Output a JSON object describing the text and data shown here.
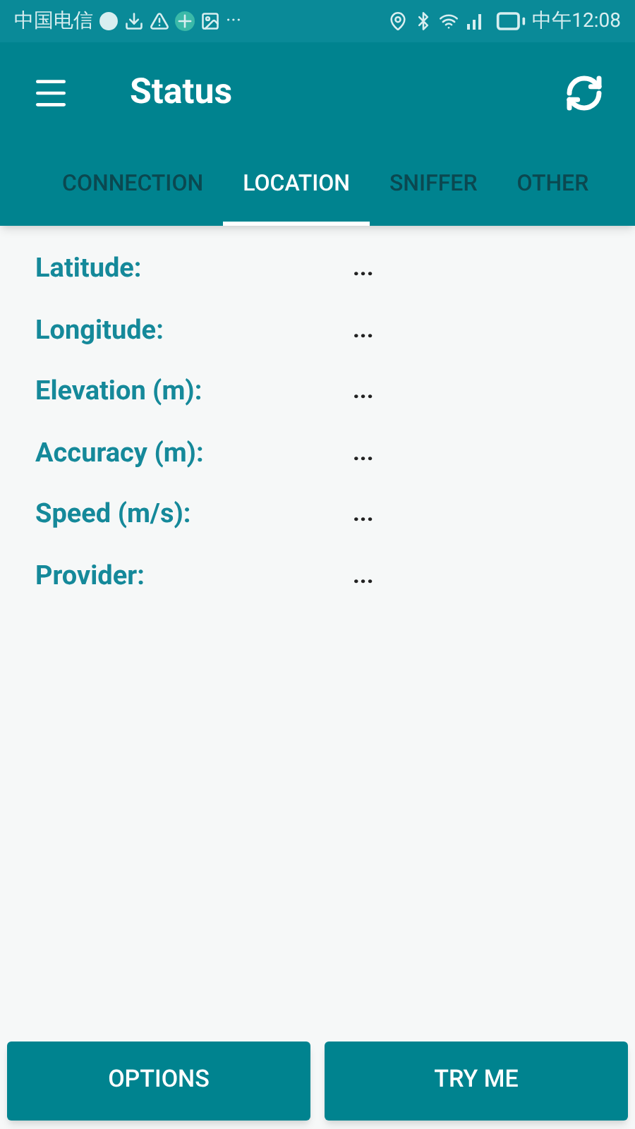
{
  "status_bar": {
    "carrier": "中国电信",
    "more": "···",
    "time": "中午12:08"
  },
  "app_bar": {
    "title": "Status"
  },
  "tabs": [
    {
      "label": "CONNECTION",
      "selected": false
    },
    {
      "label": "LOCATION",
      "selected": true
    },
    {
      "label": "SNIFFER",
      "selected": false
    },
    {
      "label": "OTHER",
      "selected": false
    }
  ],
  "fields": [
    {
      "label": "Latitude:",
      "value": "..."
    },
    {
      "label": "Longitude:",
      "value": "..."
    },
    {
      "label": "Elevation (m):",
      "value": "..."
    },
    {
      "label": "Accuracy (m):",
      "value": "..."
    },
    {
      "label": "Speed (m/s):",
      "value": "..."
    },
    {
      "label": "Provider:",
      "value": "..."
    }
  ],
  "buttons": [
    "OPTIONS",
    "TRY ME"
  ]
}
